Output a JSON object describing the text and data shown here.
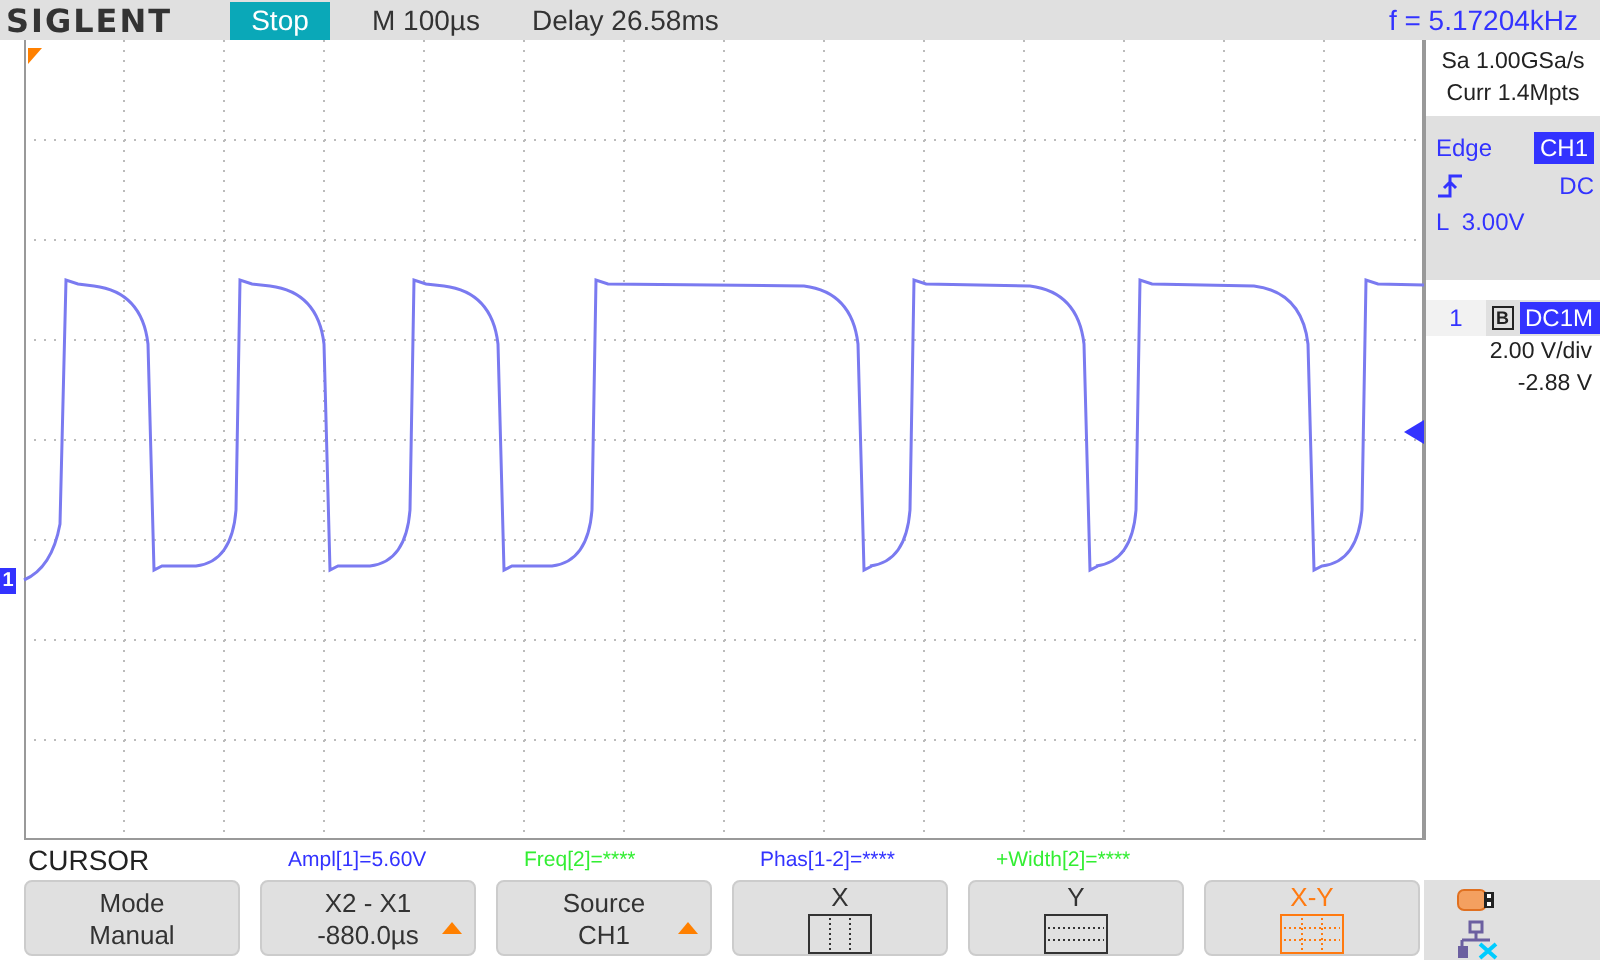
{
  "header": {
    "brand": "SIGLENT",
    "run_state": "Stop",
    "timebase": "M 100µs",
    "delay": "Delay 26.58ms",
    "frequency": "f = 5.17204kHz"
  },
  "acquisition": {
    "sample_rate": "Sa 1.00GSa/s",
    "memory": "Curr 1.4Mpts"
  },
  "trigger": {
    "type": "Edge",
    "source": "CH1",
    "coupling": "DC",
    "level": "L  3.00V"
  },
  "channel": {
    "number": "1",
    "bandwidth_limit": "B",
    "coupling": "DC1M",
    "scale": "2.00 V/div",
    "offset": "-2.88 V"
  },
  "screen": {
    "channel_marker": "1"
  },
  "menu": {
    "title": "CURSOR",
    "measurements": [
      {
        "text": "Ampl[1]=5.60V",
        "color": "#3333ff"
      },
      {
        "text": "Freq[2]=****",
        "color": "#33ee33"
      },
      {
        "text": "Phas[1-2]=****",
        "color": "#3333ff"
      },
      {
        "text": "+Width[2]=****",
        "color": "#33ee33"
      }
    ],
    "buttons": [
      {
        "kind": "text",
        "label": "Mode",
        "value": "Manual",
        "adjustable": false,
        "selected": false
      },
      {
        "kind": "text",
        "label": "X2 - X1",
        "value": "-880.0µs",
        "adjustable": true,
        "selected": false
      },
      {
        "kind": "text",
        "label": "Source",
        "value": "CH1",
        "adjustable": true,
        "selected": false
      },
      {
        "kind": "x_cursor",
        "label": "X",
        "selected": false
      },
      {
        "kind": "y_cursor",
        "label": "Y",
        "selected": false
      },
      {
        "kind": "xy_cursor",
        "label": "X-Y",
        "selected": true
      }
    ]
  }
}
